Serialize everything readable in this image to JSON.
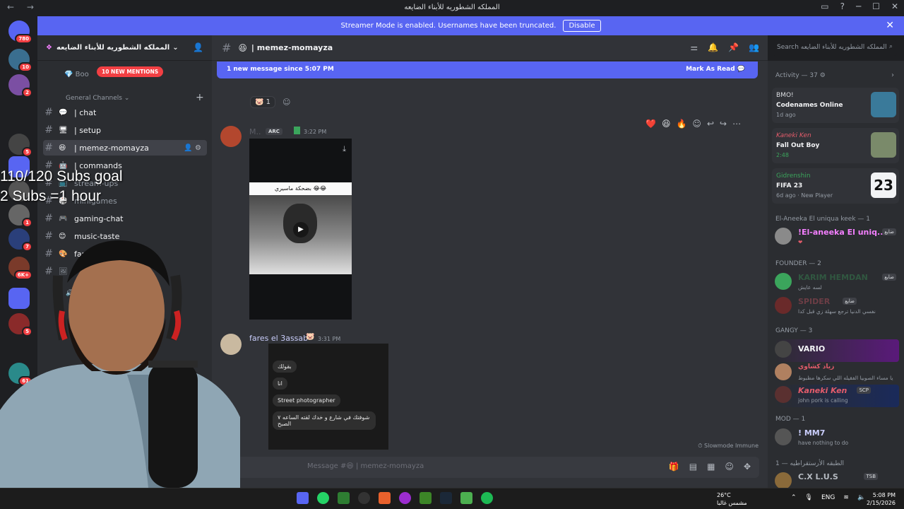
{
  "window": {
    "title": "المملكه الشطوريه للأبناء الضايعه",
    "nav_back": "←",
    "nav_fwd": "→",
    "controls": [
      "▭",
      "?",
      "─",
      "☐",
      "✕"
    ]
  },
  "banner": {
    "text": "Streamer Mode is enabled. Usernames have been truncated.",
    "button": "Disable"
  },
  "server_badges": [
    "780",
    "10",
    "2",
    "5",
    "1",
    "7",
    "6K+",
    "5",
    "61"
  ],
  "guild": {
    "name": "المملكه الشطوريه للأبناء الضايعه",
    "mentions_pill": "10 NEW MENTIONS",
    "boost_label": "Boo",
    "category_general": "General Channels",
    "category_voice": "Vo",
    "channels": [
      {
        "emoji": "💬",
        "name": "| chat"
      },
      {
        "emoji": "🖥",
        "name": "| setup"
      },
      {
        "emoji": "😆",
        "name": "| memez-momayza"
      },
      {
        "emoji": "🤖",
        "name": "| commands"
      },
      {
        "emoji": "📺",
        "name": "stream-ups"
      },
      {
        "emoji": "🎲",
        "name": "minigames"
      },
      {
        "emoji": "🎮",
        "name": "gaming-chat"
      },
      {
        "emoji": "😊",
        "name": "music-taste"
      },
      {
        "emoji": "🎨",
        "name": "fan-"
      },
      {
        "emoji": "🖼",
        "name": ""
      }
    ]
  },
  "channel": {
    "name": "| memez-momayza",
    "emoji": "😆",
    "search_placeholder": "Search المملكه الشطوريه للأبناء الضايعه"
  },
  "messages": {
    "new_since": "1 new message since 5:07 PM",
    "mark_read": "Mark As Read",
    "reaction_count": "1",
    "msg1": {
      "user": "M..",
      "tag": "ARC",
      "time": "3:22 PM",
      "caption": "بضحكة ماسيري 😂😂"
    },
    "msg2": {
      "user": "fares el 3assab",
      "time": "3:31 PM"
    },
    "bubbles": [
      "بقولك",
      "انا",
      "Street photographer",
      "شوفتك في شارع و خدك لقته الساعه ٧ الصبح"
    ],
    "slowmode": "Slowmode Immune",
    "composer_placeholder": "Message #😆 | memez-momayza"
  },
  "overlay": {
    "line1": "110/120 Subs goal",
    "line2": "2 Subs =1 hour"
  },
  "members": {
    "activity_header": "Activity — 37",
    "activities": [
      {
        "who": "BMO!",
        "what": "Codenames Online",
        "when": "1d ago",
        "who_color": "#dbdee1"
      },
      {
        "who": "Kaneki Ken",
        "what": "Fall Out Boy",
        "when": "2:48",
        "who_color": "#e45c6b"
      },
      {
        "who": "Gidrenshin",
        "what": "FIFA 23",
        "when": "6d ago · New Player",
        "who_color": "#3ba55c"
      }
    ],
    "groups": [
      {
        "title": "El-Aneeka El uniqua keek — 1",
        "members": [
          {
            "name": "!El-aneeka El uniq...",
            "status": "❤",
            "tag": "ضايع",
            "color": "#f47fff"
          }
        ]
      },
      {
        "title": "FOUNDER — 2",
        "members": [
          {
            "name": "KARIM HEMDAN",
            "status": "لسه عايش",
            "tag": "ضايع",
            "color": "#3ba55c"
          },
          {
            "name": "SPIDER",
            "status": "نفسي الدنيا ترجع سهلة زي قبل كدا",
            "tag": "ضايع",
            "color": "#e45c6b"
          }
        ]
      },
      {
        "title": "GANGY — 3",
        "members": [
          {
            "name": "VARIO",
            "status": "",
            "tag": "",
            "color": "#f2f3f5"
          },
          {
            "name": "زياد كشاوي",
            "status": "يا مساء الصوبيا الفقيله اللي سكرها مظبوط",
            "tag": "",
            "color": "#e45c6b"
          },
          {
            "name": "Kaneki Ken",
            "status": "john pork is calling",
            "tag": "SCP",
            "color": "#e45c6b"
          }
        ]
      },
      {
        "title": "MOD — 1",
        "members": [
          {
            "name": "! MM7",
            "status": "have nothing to do",
            "tag": "",
            "color": "#c9cdfb"
          }
        ]
      },
      {
        "title": "الطبقه الأرستقراطيه — 1",
        "members": [
          {
            "name": "C.X L.U.S",
            "status": "",
            "tag": "TSB",
            "color": "#b5bac1"
          }
        ]
      }
    ]
  },
  "taskbar": {
    "weather_temp": "26°C",
    "weather_desc": "مشمس غالبا",
    "lang": "ENG",
    "time": "5:08 PM",
    "date": "2/15/2026"
  }
}
